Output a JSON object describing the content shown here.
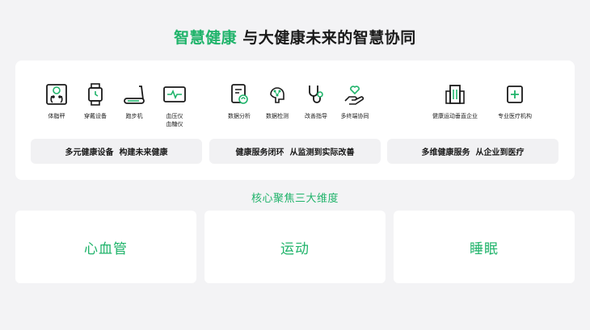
{
  "title": {
    "accent": "智慧健康",
    "rest": " 与大健康未来的智慧协同"
  },
  "groups": [
    {
      "items": [
        {
          "label": "体脂秤",
          "icon": "body-scale-icon"
        },
        {
          "label": "穿戴设备",
          "icon": "smartwatch-icon"
        },
        {
          "label": "跑步机",
          "icon": "treadmill-icon"
        },
        {
          "label": "血压仪\n血糖仪",
          "icon": "blood-pressure-monitor-icon"
        }
      ],
      "pill": "多元健康设备  构建未来健康"
    },
    {
      "items": [
        {
          "label": "数据分析",
          "icon": "data-analysis-icon"
        },
        {
          "label": "数据检测",
          "icon": "ai-brain-icon"
        },
        {
          "label": "改善指导",
          "icon": "stethoscope-icon"
        },
        {
          "label": "多终端协同",
          "icon": "heart-hand-icon"
        }
      ],
      "pill": "健康服务闭环  从监测到实际改善"
    },
    {
      "items": [
        {
          "label": "健康运动垂直企业",
          "icon": "building-icon"
        },
        {
          "label": "专业医疗机构",
          "icon": "medical-cross-icon"
        }
      ],
      "pill": "多维健康服务  从企业到医疗"
    }
  ],
  "subtitle": "核心聚焦三大维度",
  "dimensions": [
    "心血管",
    "运动",
    "睡眠"
  ],
  "colors": {
    "accent": "#1fb36a",
    "background": "#f3f3f5",
    "card": "#ffffff",
    "pill": "#f1f1f3"
  }
}
